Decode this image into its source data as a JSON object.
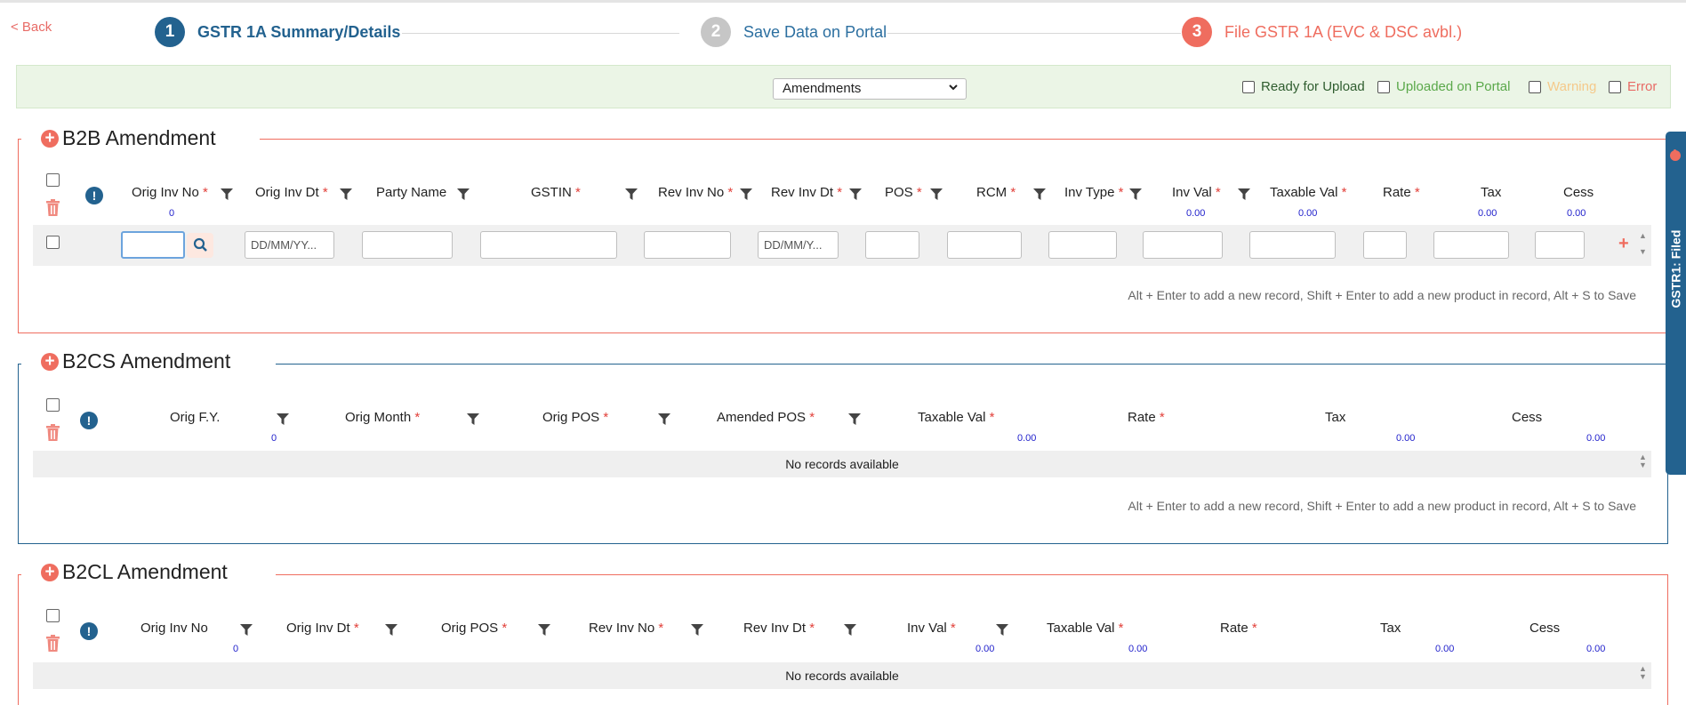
{
  "back_label": "< Back",
  "steps": [
    {
      "num": "1",
      "label": "GSTR 1A Summary/Details"
    },
    {
      "num": "2",
      "label": "Save Data on Portal"
    },
    {
      "num": "3",
      "label": "File GSTR 1A (EVC & DSC avbl.)"
    }
  ],
  "filter": {
    "view_selected": "Amendments",
    "checkboxes": [
      {
        "label": "Ready for Upload",
        "color": "#2f5d2f"
      },
      {
        "label": "Uploaded on Portal",
        "color": "#5aa84a"
      },
      {
        "label": "Warning",
        "color": "#f5c98a"
      },
      {
        "label": "Error",
        "color": "#e86b66"
      }
    ]
  },
  "hint_text": "Alt + Enter to add a new record, Shift + Enter to add a new product in record, Alt + S to Save",
  "no_records": "No records available",
  "b2b": {
    "title": "B2B Amendment",
    "columns": [
      "Orig Inv No",
      "Orig Inv Dt",
      "Party Name",
      "GSTIN",
      "Rev Inv No",
      "Rev Inv Dt",
      "POS",
      "RCM",
      "Inv Type",
      "Inv Val",
      "Taxable Val",
      "Rate",
      "Tax",
      "Cess"
    ],
    "sums": {
      "orig_inv_no": "0",
      "inv_val": "0.00",
      "taxable_val": "0.00",
      "tax": "0.00",
      "cess": "0.00"
    },
    "date_placeholder": "DD/MM/YY...",
    "date_placeholder2": "DD/MM/Y..."
  },
  "b2cs": {
    "title": "B2CS Amendment",
    "columns": [
      "Orig F.Y.",
      "Orig Month",
      "Orig POS",
      "Amended POS",
      "Taxable Val",
      "Rate",
      "Tax",
      "Cess"
    ],
    "sums": {
      "orig_fy": "0",
      "taxable_val": "0.00",
      "tax": "0.00",
      "cess": "0.00"
    }
  },
  "b2cl": {
    "title": "B2CL Amendment",
    "columns": [
      "Orig Inv No",
      "Orig Inv Dt",
      "Orig POS",
      "Rev Inv No",
      "Rev Inv Dt",
      "Inv Val",
      "Taxable Val",
      "Rate",
      "Tax",
      "Cess"
    ],
    "sums": {
      "orig_inv_no": "0",
      "inv_val": "0.00",
      "taxable_val": "0.00",
      "tax": "0.00",
      "cess": "0.00"
    }
  },
  "side_tab": "GSTR1: Filed",
  "required_mark": "*"
}
